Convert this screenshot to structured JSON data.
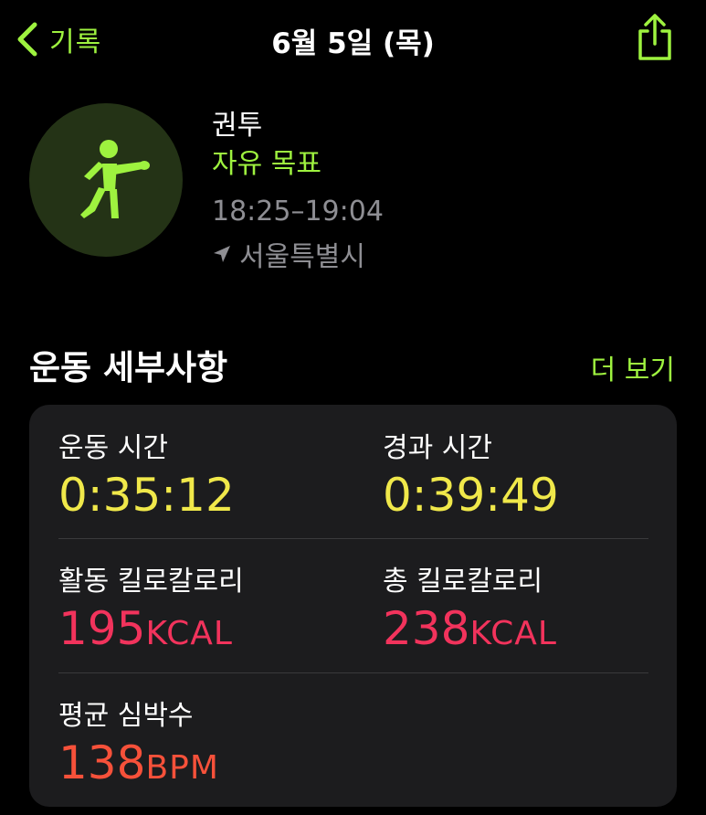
{
  "nav": {
    "back_label": "기록",
    "title": "6월 5일 (목)"
  },
  "workout": {
    "name": "권투",
    "goal": "자유 목표",
    "time_range": "18:25–19:04",
    "location": "서울특별시"
  },
  "details": {
    "section_title": "운동 세부사항",
    "more_label": "더 보기",
    "workout_time": {
      "label": "운동 시간",
      "value": "0:35:12"
    },
    "elapsed_time": {
      "label": "경과 시간",
      "value": "0:39:49"
    },
    "active_calories": {
      "label": "활동 킬로칼로리",
      "value": "195",
      "unit": "KCAL"
    },
    "total_calories": {
      "label": "총 킬로칼로리",
      "value": "238",
      "unit": "KCAL"
    },
    "avg_heart_rate": {
      "label": "평균 심박수",
      "value": "138",
      "unit": "BPM"
    }
  },
  "colors": {
    "accent": "#9ef23f",
    "time": "#f0e84a",
    "calories": "#f2335c",
    "heart_rate": "#f6513a",
    "card": "#1c1c1e",
    "secondary_text": "#8e8e93"
  },
  "icons": {
    "back": "chevron-left-icon",
    "share": "share-icon",
    "workout": "boxing-figure-icon",
    "location": "location-arrow-icon"
  }
}
